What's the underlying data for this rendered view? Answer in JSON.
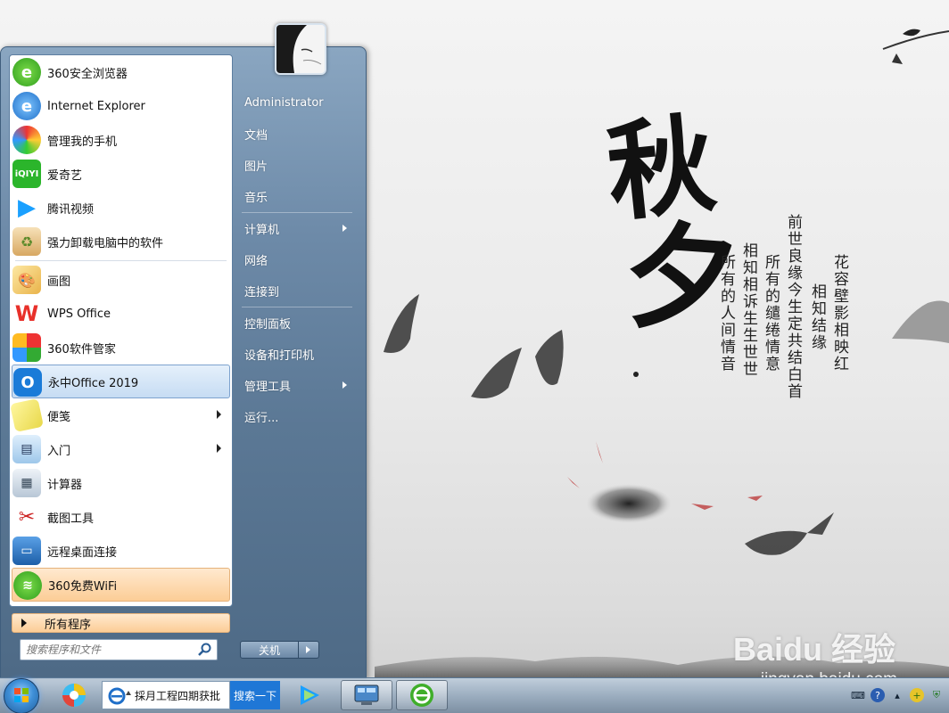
{
  "start_menu": {
    "programs": [
      {
        "label": "360安全浏览器",
        "icon": "360-browser-icon"
      },
      {
        "label": "Internet Explorer",
        "icon": "ie-icon"
      },
      {
        "label": "管理我的手机",
        "icon": "phone-manager-icon"
      },
      {
        "label": "爱奇艺",
        "icon": "iqiyi-icon"
      },
      {
        "label": "腾讯视频",
        "icon": "tencent-video-icon"
      },
      {
        "label": "强力卸载电脑中的软件",
        "icon": "uninstall-icon"
      },
      {
        "label": "画图",
        "icon": "paint-icon"
      },
      {
        "label": "WPS Office",
        "icon": "wps-icon"
      },
      {
        "label": "360软件管家",
        "icon": "360-software-icon"
      },
      {
        "label": "永中Office 2019",
        "icon": "yozo-office-icon"
      },
      {
        "label": "便笺",
        "icon": "sticky-notes-icon"
      },
      {
        "label": "入门",
        "icon": "getting-started-icon"
      },
      {
        "label": "计算器",
        "icon": "calculator-icon"
      },
      {
        "label": "截图工具",
        "icon": "snipping-tool-icon"
      },
      {
        "label": "远程桌面连接",
        "icon": "remote-desktop-icon"
      },
      {
        "label": "360免费WiFi",
        "icon": "wifi-icon"
      }
    ],
    "all_programs": "所有程序",
    "search_placeholder": "搜索程序和文件",
    "right_items": [
      {
        "label": "Administrator"
      },
      {
        "label": "文档"
      },
      {
        "label": "图片"
      },
      {
        "label": "音乐"
      },
      {
        "label": "计算机"
      },
      {
        "label": "网络"
      },
      {
        "label": "连接到"
      },
      {
        "label": "控制面板"
      },
      {
        "label": "设备和打印机"
      },
      {
        "label": "管理工具"
      },
      {
        "label": "运行..."
      }
    ],
    "shutdown_label": "关机"
  },
  "taskbar": {
    "search_text": "採月工程四期获批",
    "search_button": "搜索一下"
  },
  "wallpaper": {
    "title_1": "秋",
    "title_2": "夕",
    "poem_lines": [
      "花容壁影相映红",
      "相知结缘",
      "前世良缘今生定共结白首",
      "所有的缱绻情意",
      "相知相诉生生世世",
      "所有的人间情音"
    ]
  },
  "watermark": {
    "brand": "Baidu 经验",
    "url": "jingyan.baidu.com"
  },
  "colors": {
    "menu_blue": "#6d8aa8",
    "highlight": "#c6dcf3",
    "wifi_orange": "#fccd96"
  }
}
